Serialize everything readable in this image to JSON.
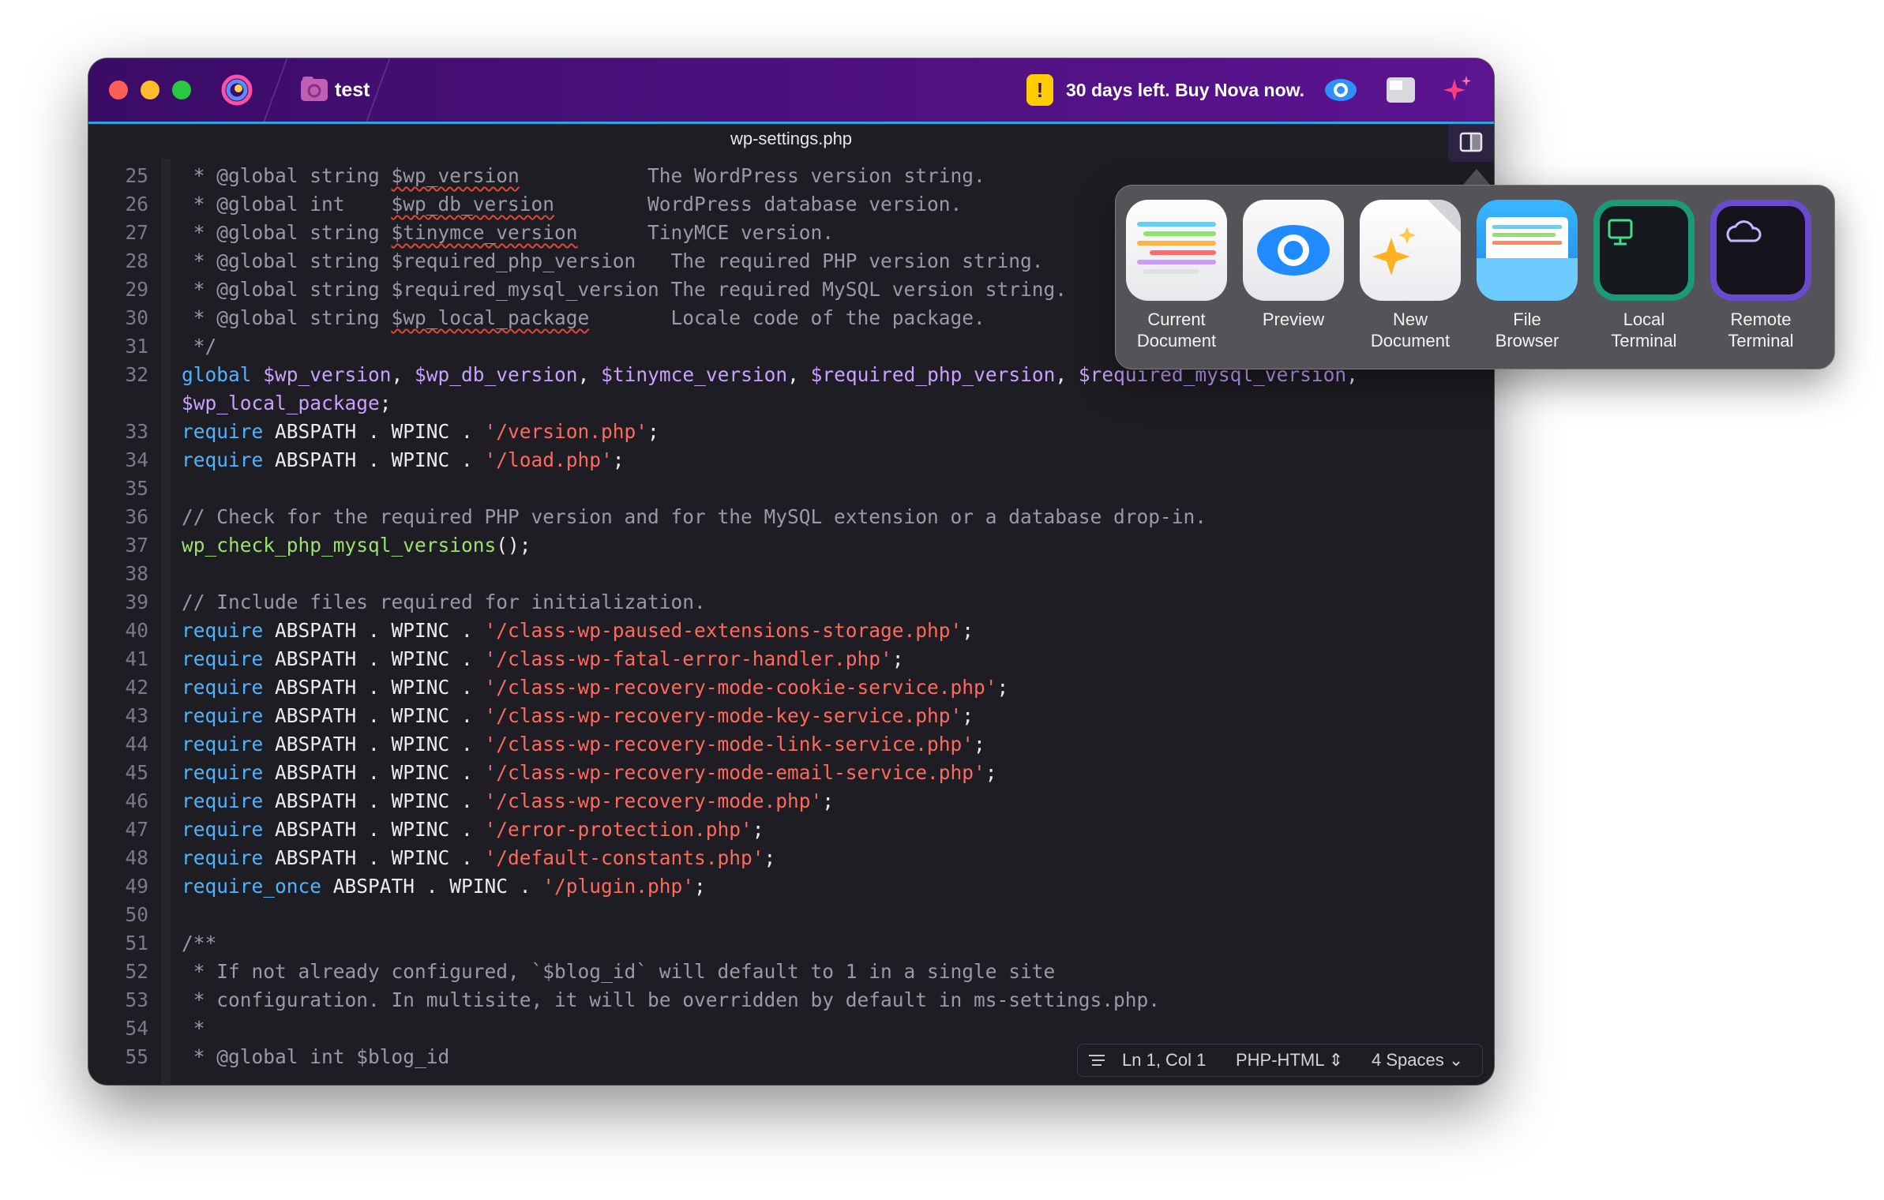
{
  "titlebar": {
    "project_name": "test",
    "trial_message": "30 days left. Buy Nova now."
  },
  "tab": {
    "filename": "wp-settings.php"
  },
  "code_lines": [
    {
      "n": "25",
      "parts": [
        {
          "t": " * @global string ",
          "c": "com"
        },
        {
          "t": "$wp_version",
          "c": "com sq"
        },
        {
          "t": "           The WordPress version string.",
          "c": "com"
        }
      ]
    },
    {
      "n": "26",
      "parts": [
        {
          "t": " * @global int    ",
          "c": "com"
        },
        {
          "t": "$wp_db_version",
          "c": "com sq"
        },
        {
          "t": "        WordPress database version.",
          "c": "com"
        }
      ]
    },
    {
      "n": "27",
      "parts": [
        {
          "t": " * @global string ",
          "c": "com"
        },
        {
          "t": "$tinymce_version",
          "c": "com sq"
        },
        {
          "t": "      TinyMCE version.",
          "c": "com"
        }
      ]
    },
    {
      "n": "28",
      "parts": [
        {
          "t": " * @global string $required_php_version   The required PHP version string.",
          "c": "com"
        }
      ]
    },
    {
      "n": "29",
      "parts": [
        {
          "t": " * @global string $required_mysql_version The required MySQL version string.",
          "c": "com"
        }
      ]
    },
    {
      "n": "30",
      "parts": [
        {
          "t": " * @global string ",
          "c": "com"
        },
        {
          "t": "$wp_local_package",
          "c": "com sq"
        },
        {
          "t": "       Locale code of the package.",
          "c": "com"
        }
      ]
    },
    {
      "n": "31",
      "parts": [
        {
          "t": " */",
          "c": "com"
        }
      ]
    },
    {
      "n": "32",
      "parts": [
        {
          "t": "global ",
          "c": "kw"
        },
        {
          "t": "$wp_version",
          "c": "var"
        },
        {
          "t": ", ",
          "c": "plain"
        },
        {
          "t": "$wp_db_version",
          "c": "var"
        },
        {
          "t": ", ",
          "c": "plain"
        },
        {
          "t": "$tinymce_version",
          "c": "var"
        },
        {
          "t": ", ",
          "c": "plain"
        },
        {
          "t": "$required_php_version",
          "c": "var"
        },
        {
          "t": ", ",
          "c": "plain"
        },
        {
          "t": "$required_mysql_version",
          "c": "var"
        },
        {
          "t": ",",
          "c": "plain"
        }
      ]
    },
    {
      "n": "",
      "parts": [
        {
          "t": "$wp_local_package",
          "c": "var"
        },
        {
          "t": ";",
          "c": "plain"
        }
      ]
    },
    {
      "n": "33",
      "parts": [
        {
          "t": "require",
          "c": "kw"
        },
        {
          "t": " ABSPATH . WPINC . ",
          "c": "plain"
        },
        {
          "t": "'/version.php'",
          "c": "str"
        },
        {
          "t": ";",
          "c": "plain"
        }
      ]
    },
    {
      "n": "34",
      "parts": [
        {
          "t": "require",
          "c": "kw"
        },
        {
          "t": " ABSPATH . WPINC . ",
          "c": "plain"
        },
        {
          "t": "'/load.php'",
          "c": "str"
        },
        {
          "t": ";",
          "c": "plain"
        }
      ]
    },
    {
      "n": "35",
      "parts": []
    },
    {
      "n": "36",
      "parts": [
        {
          "t": "// Check for the required PHP version and for the MySQL extension or a database drop-in.",
          "c": "com"
        }
      ]
    },
    {
      "n": "37",
      "parts": [
        {
          "t": "wp_check_php_mysql_versions",
          "c": "fn"
        },
        {
          "t": "();",
          "c": "plain"
        }
      ]
    },
    {
      "n": "38",
      "parts": []
    },
    {
      "n": "39",
      "parts": [
        {
          "t": "// Include files required for initialization.",
          "c": "com"
        }
      ]
    },
    {
      "n": "40",
      "parts": [
        {
          "t": "require",
          "c": "kw"
        },
        {
          "t": " ABSPATH . WPINC . ",
          "c": "plain"
        },
        {
          "t": "'/class-wp-paused-extensions-storage.php'",
          "c": "str"
        },
        {
          "t": ";",
          "c": "plain"
        }
      ]
    },
    {
      "n": "41",
      "parts": [
        {
          "t": "require",
          "c": "kw"
        },
        {
          "t": " ABSPATH . WPINC . ",
          "c": "plain"
        },
        {
          "t": "'/class-wp-fatal-error-handler.php'",
          "c": "str"
        },
        {
          "t": ";",
          "c": "plain"
        }
      ]
    },
    {
      "n": "42",
      "parts": [
        {
          "t": "require",
          "c": "kw"
        },
        {
          "t": " ABSPATH . WPINC . ",
          "c": "plain"
        },
        {
          "t": "'/class-wp-recovery-mode-cookie-service.php'",
          "c": "str"
        },
        {
          "t": ";",
          "c": "plain"
        }
      ]
    },
    {
      "n": "43",
      "parts": [
        {
          "t": "require",
          "c": "kw"
        },
        {
          "t": " ABSPATH . WPINC . ",
          "c": "plain"
        },
        {
          "t": "'/class-wp-recovery-mode-key-service.php'",
          "c": "str"
        },
        {
          "t": ";",
          "c": "plain"
        }
      ]
    },
    {
      "n": "44",
      "parts": [
        {
          "t": "require",
          "c": "kw"
        },
        {
          "t": " ABSPATH . WPINC . ",
          "c": "plain"
        },
        {
          "t": "'/class-wp-recovery-mode-link-service.php'",
          "c": "str"
        },
        {
          "t": ";",
          "c": "plain"
        }
      ]
    },
    {
      "n": "45",
      "parts": [
        {
          "t": "require",
          "c": "kw"
        },
        {
          "t": " ABSPATH . WPINC . ",
          "c": "plain"
        },
        {
          "t": "'/class-wp-recovery-mode-email-service.php'",
          "c": "str"
        },
        {
          "t": ";",
          "c": "plain"
        }
      ]
    },
    {
      "n": "46",
      "parts": [
        {
          "t": "require",
          "c": "kw"
        },
        {
          "t": " ABSPATH . WPINC . ",
          "c": "plain"
        },
        {
          "t": "'/class-wp-recovery-mode.php'",
          "c": "str"
        },
        {
          "t": ";",
          "c": "plain"
        }
      ]
    },
    {
      "n": "47",
      "parts": [
        {
          "t": "require",
          "c": "kw"
        },
        {
          "t": " ABSPATH . WPINC . ",
          "c": "plain"
        },
        {
          "t": "'/error-protection.php'",
          "c": "str"
        },
        {
          "t": ";",
          "c": "plain"
        }
      ]
    },
    {
      "n": "48",
      "parts": [
        {
          "t": "require",
          "c": "kw"
        },
        {
          "t": " ABSPATH . WPINC . ",
          "c": "plain"
        },
        {
          "t": "'/default-constants.php'",
          "c": "str"
        },
        {
          "t": ";",
          "c": "plain"
        }
      ]
    },
    {
      "n": "49",
      "parts": [
        {
          "t": "require_once",
          "c": "kw"
        },
        {
          "t": " ABSPATH . WPINC . ",
          "c": "plain"
        },
        {
          "t": "'/plugin.php'",
          "c": "str"
        },
        {
          "t": ";",
          "c": "plain"
        }
      ]
    },
    {
      "n": "50",
      "parts": []
    },
    {
      "n": "51",
      "parts": [
        {
          "t": "/**",
          "c": "com"
        }
      ]
    },
    {
      "n": "52",
      "parts": [
        {
          "t": " * If not already configured, `$blog_id` will default to 1 in a single site",
          "c": "com"
        }
      ]
    },
    {
      "n": "53",
      "parts": [
        {
          "t": " * configuration. In multisite, it will be overridden by default in ms-settings.php.",
          "c": "com"
        }
      ]
    },
    {
      "n": "54",
      "parts": [
        {
          "t": " *",
          "c": "com"
        }
      ]
    },
    {
      "n": "55",
      "parts": [
        {
          "t": " * @global int $blog_id",
          "c": "com"
        }
      ]
    }
  ],
  "statusbar": {
    "position": "Ln 1, Col 1",
    "syntax": "PHP-HTML",
    "indentation": "4 Spaces"
  },
  "popover": {
    "items": [
      {
        "line1": "Current",
        "line2": "Document",
        "icon": "current-document-icon"
      },
      {
        "line1": "Preview",
        "line2": "",
        "icon": "preview-icon"
      },
      {
        "line1": "New",
        "line2": "Document",
        "icon": "new-document-icon"
      },
      {
        "line1": "File",
        "line2": "Browser",
        "icon": "file-browser-icon"
      },
      {
        "line1": "Local",
        "line2": "Terminal",
        "icon": "local-terminal-icon"
      },
      {
        "line1": "Remote",
        "line2": "Terminal",
        "icon": "remote-terminal-icon"
      }
    ]
  },
  "colors": {
    "titlebar": "#4b107d",
    "editor_bg": "#1d1d23",
    "keyword": "#4fb4ff",
    "variable": "#c9a2ff",
    "string": "#ff6a5c",
    "function": "#9be26e",
    "comment": "#9a9aa2"
  }
}
